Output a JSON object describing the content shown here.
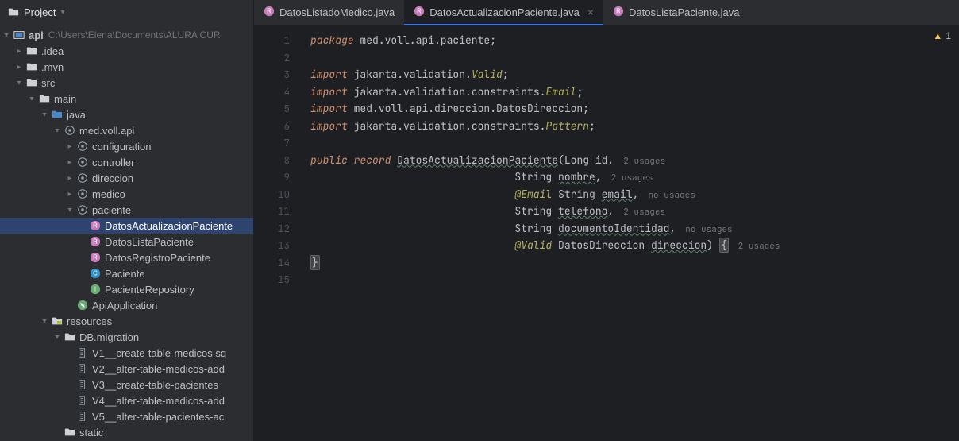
{
  "sidebar": {
    "title": "Project",
    "root": {
      "label": "api",
      "meta": "C:\\Users\\Elena\\Documents\\ALURA CUR"
    },
    "tree": [
      {
        "indent": 1,
        "arrow": ">",
        "icon": "folder",
        "label": ".idea"
      },
      {
        "indent": 1,
        "arrow": ">",
        "icon": "folder",
        "label": ".mvn"
      },
      {
        "indent": 1,
        "arrow": "v",
        "icon": "folder",
        "label": "src"
      },
      {
        "indent": 2,
        "arrow": "v",
        "icon": "folder",
        "label": "main"
      },
      {
        "indent": 3,
        "arrow": "v",
        "icon": "folder-src",
        "label": "java"
      },
      {
        "indent": 4,
        "arrow": "v",
        "icon": "pkg",
        "label": "med.voll.api"
      },
      {
        "indent": 5,
        "arrow": ">",
        "icon": "pkg",
        "label": "configuration"
      },
      {
        "indent": 5,
        "arrow": ">",
        "icon": "pkg",
        "label": "controller"
      },
      {
        "indent": 5,
        "arrow": ">",
        "icon": "pkg",
        "label": "direccion"
      },
      {
        "indent": 5,
        "arrow": ">",
        "icon": "pkg",
        "label": "medico"
      },
      {
        "indent": 5,
        "arrow": "v",
        "icon": "pkg",
        "label": "paciente"
      },
      {
        "indent": 6,
        "arrow": "",
        "icon": "record",
        "label": "DatosActualizacionPaciente",
        "selected": true
      },
      {
        "indent": 6,
        "arrow": "",
        "icon": "record",
        "label": "DatosListaPaciente"
      },
      {
        "indent": 6,
        "arrow": "",
        "icon": "record",
        "label": "DatosRegistroPaciente"
      },
      {
        "indent": 6,
        "arrow": "",
        "icon": "class",
        "label": "Paciente"
      },
      {
        "indent": 6,
        "arrow": "",
        "icon": "interface",
        "label": "PacienteRepository"
      },
      {
        "indent": 5,
        "arrow": "",
        "icon": "spring",
        "label": "ApiApplication"
      },
      {
        "indent": 3,
        "arrow": "v",
        "icon": "folder-res",
        "label": "resources"
      },
      {
        "indent": 4,
        "arrow": "v",
        "icon": "folder",
        "label": "DB.migration"
      },
      {
        "indent": 5,
        "arrow": "",
        "icon": "sql",
        "label": "V1__create-table-medicos.sq"
      },
      {
        "indent": 5,
        "arrow": "",
        "icon": "sql",
        "label": "V2__alter-table-medicos-add"
      },
      {
        "indent": 5,
        "arrow": "",
        "icon": "sql",
        "label": "V3__create-table-pacientes"
      },
      {
        "indent": 5,
        "arrow": "",
        "icon": "sql",
        "label": "V4__alter-table-medicos-add"
      },
      {
        "indent": 5,
        "arrow": "",
        "icon": "sql",
        "label": "V5__alter-table-pacientes-ac"
      },
      {
        "indent": 4,
        "arrow": "",
        "icon": "folder",
        "label": "static"
      }
    ]
  },
  "tabs": [
    {
      "label": "DatosListadoMedico.java",
      "active": false,
      "closable": false
    },
    {
      "label": "DatosActualizacionPaciente.java",
      "active": true,
      "closable": true
    },
    {
      "label": "DatosListaPaciente.java",
      "active": false,
      "closable": false
    }
  ],
  "warn_count": "1",
  "gutter_lines": [
    "1",
    "2",
    "3",
    "4",
    "5",
    "6",
    "7",
    "8",
    "9",
    "10",
    "11",
    "12",
    "13",
    "14",
    "15"
  ],
  "code": {
    "l1_kw": "package",
    "l1_rest": " med.voll.api.paciente;",
    "l3_kw": "import",
    "l3_rest": " jakarta.validation.",
    "l3_it": "Valid",
    "l3_end": ";",
    "l4_kw": "import",
    "l4_rest": " jakarta.validation.constraints.",
    "l4_it": "Email",
    "l4_end": ";",
    "l5_kw": "import",
    "l5_rest": " med.voll.api.direccion.DatosDireccion;",
    "l6_kw": "import",
    "l6_rest": " jakarta.validation.constraints.",
    "l6_it": "Pattern",
    "l6_end": ";",
    "l8_kw1": "public",
    "l8_kw2": "record",
    "l8_name": "DatosActualizacionPaciente",
    "l8_open": "(Long id,",
    "l8_usages": "2 usages",
    "l9_pad": "                                 ",
    "l9_text": "String ",
    "l9_ident": "nombre",
    "l9_comma": ",",
    "l9_usages": "2 usages",
    "l10_pad": "                                 ",
    "l10_anno": "@Email",
    "l10_text": " String ",
    "l10_ident": "email",
    "l10_comma": ",",
    "l10_usages": "no usages",
    "l11_pad": "                                 ",
    "l11_text": "String ",
    "l11_ident": "telefono",
    "l11_comma": ",",
    "l11_usages": "2 usages",
    "l12_pad": "                                 ",
    "l12_text": "String ",
    "l12_ident": "documentoIdentidad",
    "l12_comma": ",",
    "l12_usages": "no usages",
    "l13_pad": "                                 ",
    "l13_anno": "@Valid",
    "l13_text": " DatosDireccion ",
    "l13_ident": "direccion",
    "l13_close": ")",
    "l13_brace": "{",
    "l13_usages": "2 usages",
    "l14_brace": "}"
  }
}
